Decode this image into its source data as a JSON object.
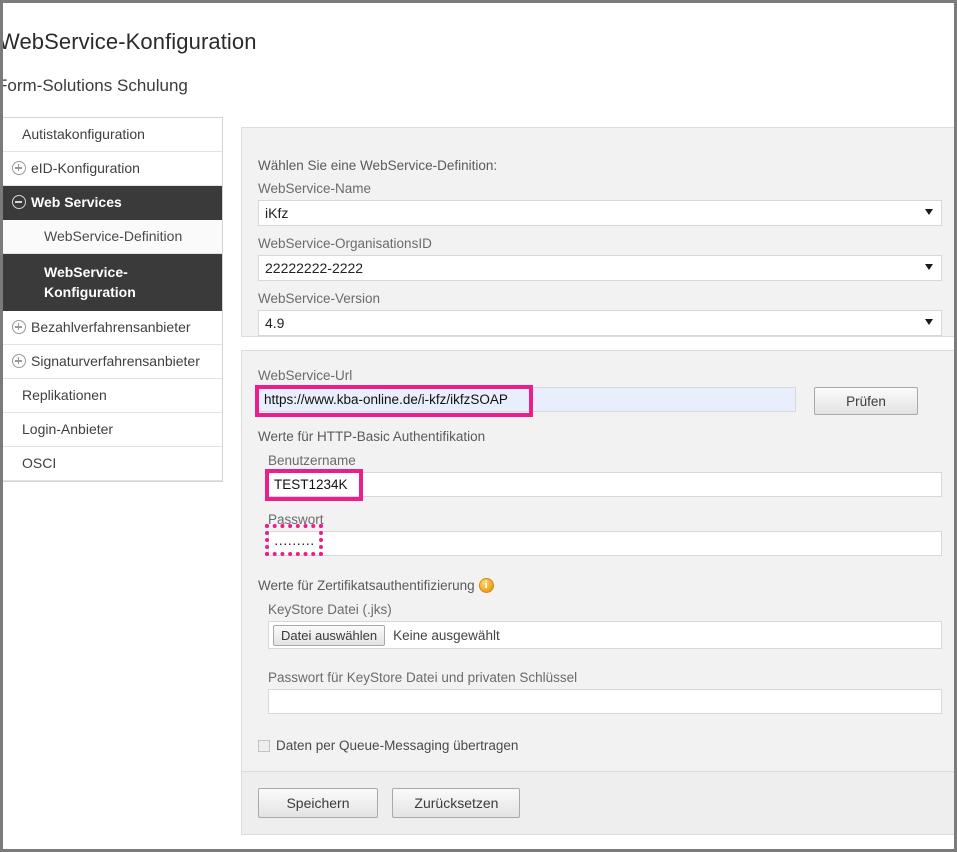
{
  "header": {
    "page_title": "WebService-Konfiguration",
    "org_title": "Form-Solutions Schulung"
  },
  "sidebar": {
    "items": [
      {
        "label": "Autistakonfiguration",
        "icon": "none",
        "state": "normal",
        "level": 0
      },
      {
        "label": "eID-Konfiguration",
        "icon": "plus-circle-icon",
        "state": "normal",
        "level": 0
      },
      {
        "label": "Web Services",
        "icon": "minus-circle-icon",
        "state": "active",
        "level": 0
      },
      {
        "label": "WebService-Definition",
        "icon": "none",
        "state": "normal",
        "level": 1
      },
      {
        "label": "WebService-Konfiguration",
        "icon": "none",
        "state": "active",
        "level": 1
      },
      {
        "label": "Bezahlverfahrensanbieter",
        "icon": "plus-circle-icon",
        "state": "normal",
        "level": 0
      },
      {
        "label": "Signaturverfahrensanbieter",
        "icon": "plus-circle-icon",
        "state": "normal",
        "level": 0
      },
      {
        "label": "Replikationen",
        "icon": "none",
        "state": "normal",
        "level": 0
      },
      {
        "label": "Login-Anbieter",
        "icon": "none",
        "state": "normal",
        "level": 0
      },
      {
        "label": "OSCI",
        "icon": "none",
        "state": "normal",
        "level": 0
      }
    ]
  },
  "definition_panel": {
    "hint": "Wählen Sie eine WebService-Definition:",
    "name_label": "WebService-Name",
    "name_value": "iKfz",
    "org_label": "WebService-OrganisationsID",
    "org_value": "22222222-2222",
    "version_label": "WebService-Version",
    "version_value": "4.9"
  },
  "config_panel": {
    "url_label": "WebService-Url",
    "url_value": "https://www.kba-online.de/i-kfz/ikfzSOAP",
    "check_button": "Prüfen",
    "basic_auth_label": "Werte für HTTP-Basic Authentifikation",
    "username_label": "Benutzername",
    "username_value": "TEST1234K",
    "password_label": "Passwort",
    "password_value": "·········",
    "cert_auth_label": "Werte für Zertifikatsauthentifizierung",
    "cert_info_icon": "info-icon",
    "keystore_label": "KeyStore Datei (.jks)",
    "file_button": "Datei auswählen",
    "file_status": "Keine ausgewählt",
    "keystore_password_label": "Passwort für KeyStore Datei und privaten Schlüssel",
    "keystore_password_value": "",
    "queue_checkbox_label": "Daten per Queue-Messaging übertragen",
    "queue_checkbox_checked": false,
    "save_button": "Speichern",
    "reset_button": "Zurücksetzen"
  },
  "annotations": {
    "highlight_color": "#ea1e8c",
    "boxes": [
      {
        "name": "url-highlight",
        "style": "solid"
      },
      {
        "name": "username-highlight",
        "style": "solid"
      },
      {
        "name": "password-highlight",
        "style": "dotted"
      }
    ]
  }
}
